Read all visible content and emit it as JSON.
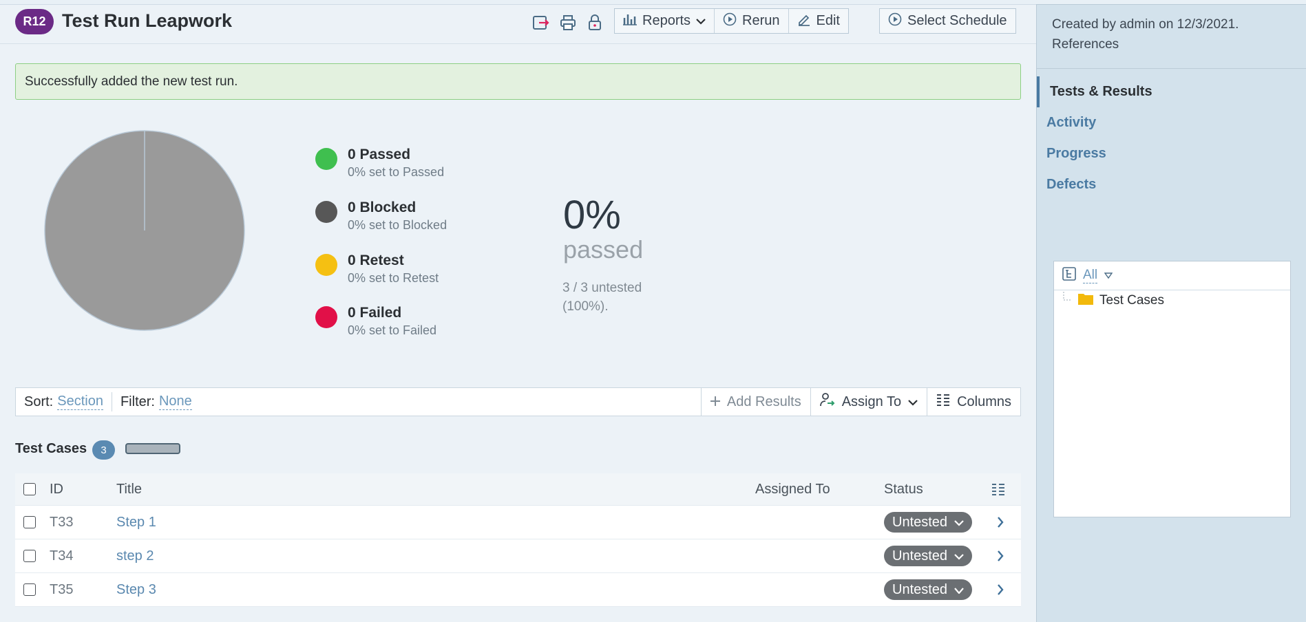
{
  "header": {
    "run_badge": "R12",
    "title": "Test Run Leapwork",
    "buttons": {
      "reports": "Reports",
      "rerun": "Rerun",
      "edit": "Edit",
      "select_schedule": "Select Schedule"
    }
  },
  "message": "Successfully added the new test run.",
  "colors": {
    "passed": "#3fbf4f",
    "blocked": "#575757",
    "retest": "#f5c012",
    "failed": "#e11048",
    "pie": "#9a9a9a",
    "run_badge": "#6b2a86"
  },
  "chart_data": {
    "type": "pie",
    "categories": [
      "Untested"
    ],
    "values": [
      3
    ]
  },
  "legend": [
    {
      "title": "0 Passed",
      "sub": "0% set to Passed"
    },
    {
      "title": "0 Blocked",
      "sub": "0% set to Blocked"
    },
    {
      "title": "0 Retest",
      "sub": "0% set to Retest"
    },
    {
      "title": "0 Failed",
      "sub": "0% set to Failed"
    }
  ],
  "summary": {
    "percent": "0%",
    "percent_label": "passed",
    "untested_line1": "3 / 3 untested",
    "untested_line2": "(100%)."
  },
  "toolbar": {
    "sort_label": "Sort:",
    "sort_value": "Section",
    "filter_label": "Filter:",
    "filter_value": "None",
    "add_results": "Add Results",
    "assign_to": "Assign To",
    "columns": "Columns"
  },
  "section": {
    "title": "Test Cases",
    "count": "3",
    "progress_fraction": 0
  },
  "table": {
    "headers": {
      "id": "ID",
      "title": "Title",
      "assigned": "Assigned To",
      "status": "Status"
    },
    "rows": [
      {
        "id": "T33",
        "title": "Step 1",
        "assigned": "",
        "status": "Untested"
      },
      {
        "id": "T34",
        "title": "step 2",
        "assigned": "",
        "status": "Untested"
      },
      {
        "id": "T35",
        "title": "Step 3",
        "assigned": "",
        "status": "Untested"
      }
    ]
  },
  "sidebar": {
    "meta_line1": "Created by admin on 12/3/2021.",
    "meta_line2": "References",
    "nav": [
      "Tests & Results",
      "Activity",
      "Progress",
      "Defects"
    ],
    "tree_filter": "All",
    "tree_root": "Test Cases"
  }
}
